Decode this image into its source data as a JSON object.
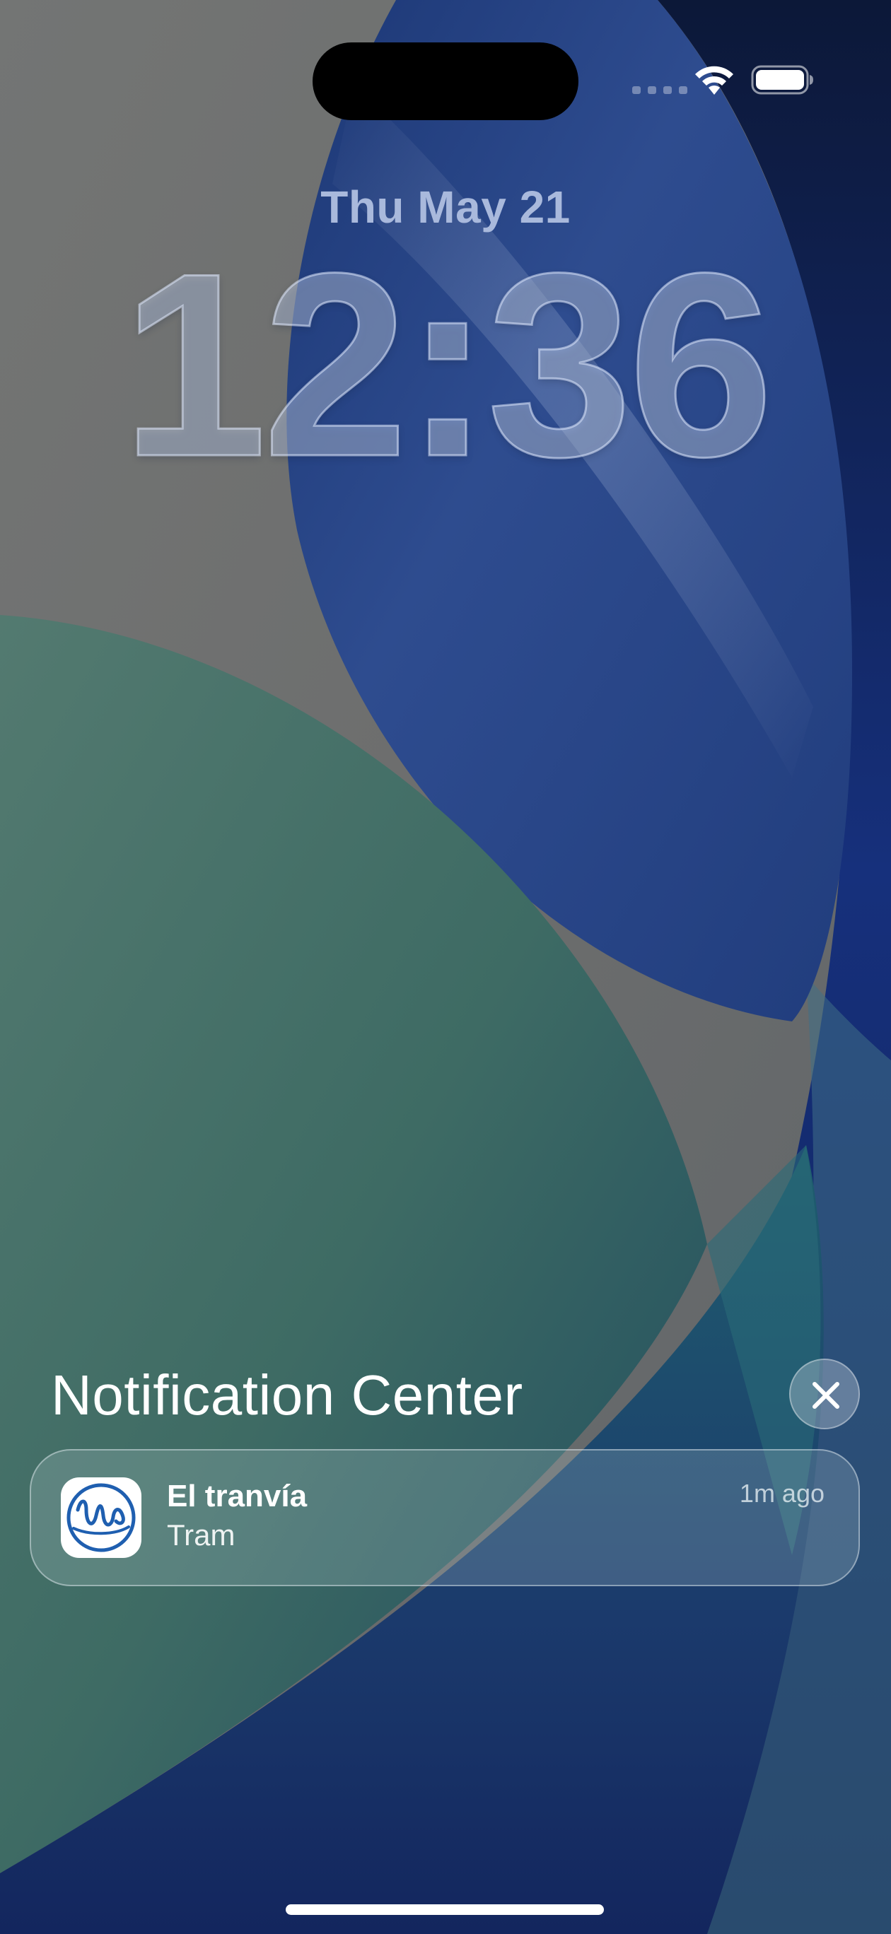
{
  "status_bar": {
    "wifi_icon": "wifi-icon",
    "battery_icon": "battery-icon",
    "signal_icon": "cellular-signal-icon"
  },
  "lock_screen": {
    "date": "Thu May 21",
    "time": "12:36"
  },
  "notification_center": {
    "title": "Notification Center",
    "close_icon": "close-icon",
    "notifications": [
      {
        "app_name": "El tranvía",
        "body": "Tram",
        "time": "1m ago",
        "icon": "tram-app-icon",
        "icon_color": "#1f5fb0"
      }
    ]
  },
  "colors": {
    "wallpaper_gray": "#6f7070",
    "wallpaper_blue": "#25407e",
    "wallpaper_green": "#3d6a63",
    "wallpaper_navy": "#0f1f58"
  }
}
